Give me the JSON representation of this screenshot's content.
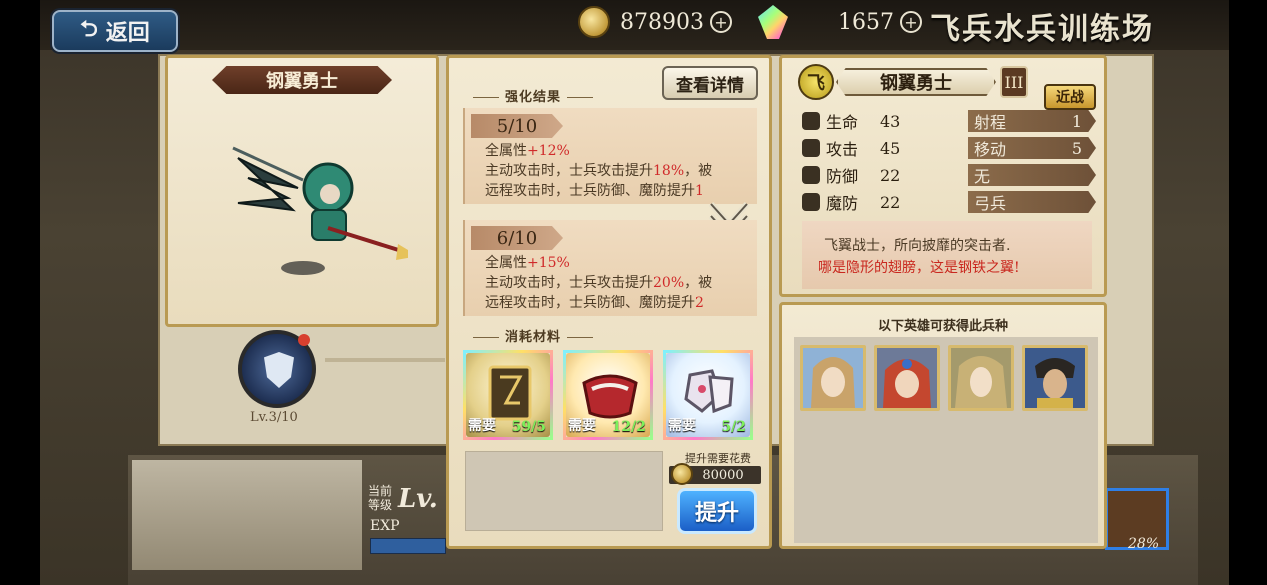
{
  "topbar": {
    "back_label": "返回",
    "gold": "878903",
    "gems": "1657",
    "title": "飞兵水兵训练场"
  },
  "unit": {
    "name": "钢翼勇士",
    "level_text": "Lv.3/10",
    "rank": "III",
    "role_tag": "近战",
    "class_glyph": "飞"
  },
  "enhance": {
    "section_title": "强化结果",
    "detail_button": "查看详情",
    "levels": [
      {
        "tag": "5/10",
        "all_attr_prefix": "全属性",
        "all_attr_value": "+12%",
        "line2_prefix": "主动攻击时，士兵攻击提升",
        "line2_value": "18%",
        "line2_suffix": "，被",
        "line3_prefix": "远程攻击时，士兵防御、魔防提升",
        "line3_value": "1"
      },
      {
        "tag": "6/10",
        "all_attr_prefix": "全属性",
        "all_attr_value": "+15%",
        "line2_prefix": "主动攻击时，士兵攻击提升",
        "line2_value": "20%",
        "line2_suffix": "，被",
        "line3_prefix": "远程攻击时，士兵防御、魔防提升",
        "line3_value": "2"
      }
    ]
  },
  "materials": {
    "section_title": "消耗材料",
    "need_label": "需要",
    "items": [
      {
        "count": "59/5"
      },
      {
        "count": "12/2"
      },
      {
        "count": "5/2"
      }
    ],
    "cost_label": "提升需要花费",
    "cost_value": "80000",
    "upgrade_button": "提升"
  },
  "stats": {
    "left": [
      {
        "label": "生命",
        "value": "43"
      },
      {
        "label": "攻击",
        "value": "45"
      },
      {
        "label": "防御",
        "value": "22"
      },
      {
        "label": "魔防",
        "value": "22"
      }
    ],
    "right": [
      {
        "icon": "",
        "label": "射程",
        "value": "1"
      },
      {
        "icon": "",
        "label": "移动",
        "value": "5"
      },
      {
        "icon": "克",
        "label": "无",
        "value": ""
      },
      {
        "icon": "弱",
        "label": "弓兵",
        "value": ""
      }
    ]
  },
  "description": {
    "line1": "飞翼战士，所向披靡的突击者.",
    "line2": "哪是隐形的翅膀，这是钢铁之翼!"
  },
  "heroes": {
    "section_title": "以下英雄可获得此兵种",
    "colors": [
      "#c9a36a",
      "#c4472f",
      "#c8b176",
      "#3c5a8c"
    ]
  },
  "lower": {
    "current_level_label_1": "当前",
    "current_level_label_2": "等级",
    "level_prefix": "Lv.",
    "exp_label": "EXP",
    "pct": "28%"
  }
}
